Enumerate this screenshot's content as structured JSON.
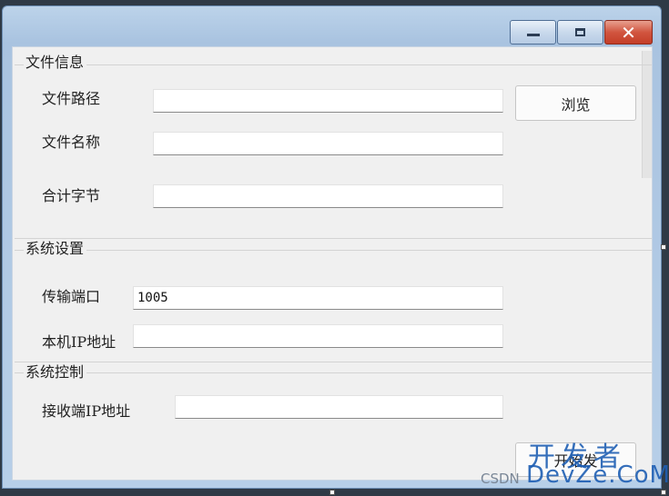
{
  "title_bar": {
    "minimize_icon": "minimize-icon",
    "maximize_icon": "maximize-icon",
    "close_icon": "close-icon",
    "close_glyph": "✕"
  },
  "file_info": {
    "group_title": "文件信息",
    "path_label": "文件路径",
    "path_value": "",
    "browse_button": "浏览",
    "name_label": "文件名称",
    "name_value": "",
    "total_bytes_label": "合计字节",
    "total_bytes_value": ""
  },
  "system_settings": {
    "group_title": "系统设置",
    "port_label": "传输端口",
    "port_value": "1005",
    "local_ip_label": "本机IP地址",
    "local_ip_value": ""
  },
  "system_control": {
    "group_title": "系统控制",
    "receiver_ip_label": "接收端IP地址",
    "receiver_ip_value": "",
    "start_button": "开始发"
  },
  "watermark": {
    "line1": "开发者",
    "line2": "DevZe.CoM",
    "csdn": "CSDN"
  },
  "colors": {
    "titlebar": "#b7cfe8",
    "client_bg": "#f0f0f0",
    "close_button": "#c43d28",
    "watermark": "#1f5fb4"
  }
}
